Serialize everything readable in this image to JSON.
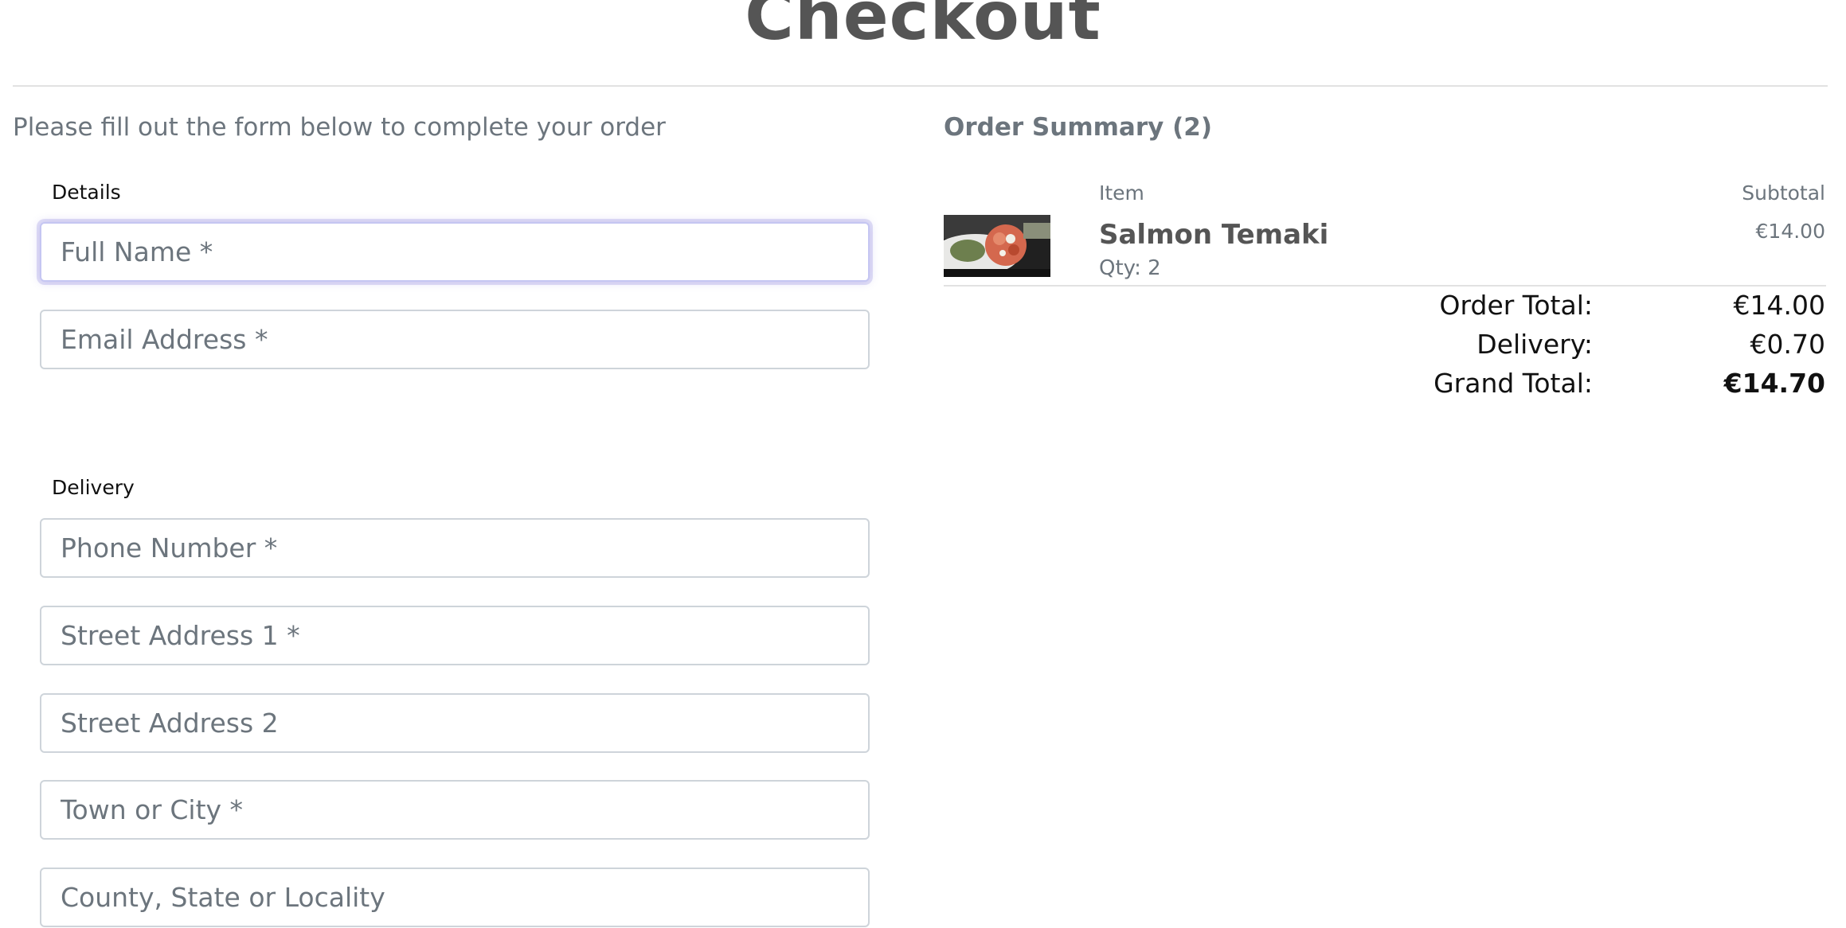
{
  "page": {
    "title": "Checkout",
    "subtitle": "Please fill out the form below to complete your order"
  },
  "details": {
    "legend": "Details",
    "full_name_placeholder": "Full Name *",
    "email_placeholder": "Email Address *"
  },
  "delivery": {
    "legend": "Delivery",
    "phone_placeholder": "Phone Number *",
    "street1_placeholder": "Street Address 1 *",
    "street2_placeholder": "Street Address 2",
    "town_placeholder": "Town or City *",
    "county_placeholder": "County, State or Locality"
  },
  "summary": {
    "title": "Order Summary (2)",
    "col_item": "Item",
    "col_subtotal": "Subtotal",
    "items": [
      {
        "name": "Salmon Temaki",
        "qty": "Qty: 2",
        "subtotal": "€14.00"
      }
    ],
    "order_total_label": "Order Total:",
    "order_total_value": "€14.00",
    "delivery_label": "Delivery:",
    "delivery_value": "€0.70",
    "grand_total_label": "Grand Total:",
    "grand_total_value": "€14.70"
  },
  "colors": {
    "heading": "#555555",
    "muted": "#6c757d",
    "focus_ring": "#c5c6f2"
  }
}
